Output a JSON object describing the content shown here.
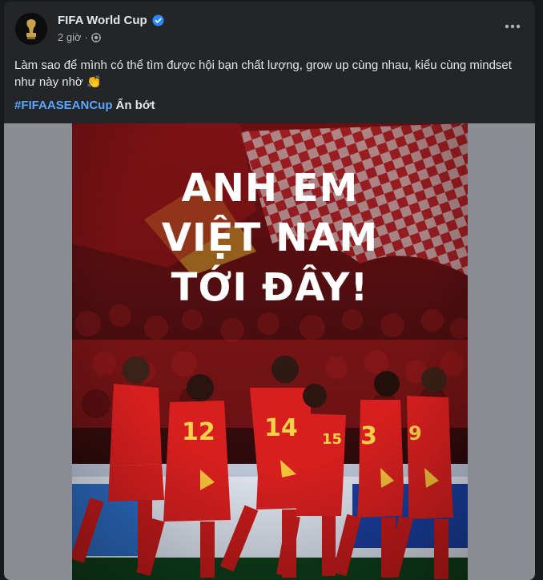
{
  "post": {
    "author": "FIFA World Cup",
    "author_verified": true,
    "time": "2 giờ",
    "privacy_icon": "globe-icon",
    "more_icon": "more-dots-icon",
    "caption_text": "Làm sao để mình có thể tìm được hội bạn chất lượng, grow up cùng nhau, kiểu cùng mindset như này nhờ",
    "caption_emoji": "👏",
    "hashtag": "#FIFAASEANCup",
    "see_less": "Ẩn bớt"
  },
  "image": {
    "headline": [
      "ANH EM",
      "VIỆT NAM",
      "TỚI ĐÂY!"
    ],
    "jersey_numbers": [
      "12",
      "14",
      "15",
      "3",
      "9"
    ]
  },
  "colors": {
    "card_bg": "#242526",
    "page_bg": "#18191a",
    "text_primary": "#e4e6eb",
    "text_secondary": "#b0b3b8",
    "link": "#5aa7ff",
    "verified": "#2d88ff",
    "jersey_red": "#d81f1f",
    "jersey_gold": "#f6c23a"
  }
}
